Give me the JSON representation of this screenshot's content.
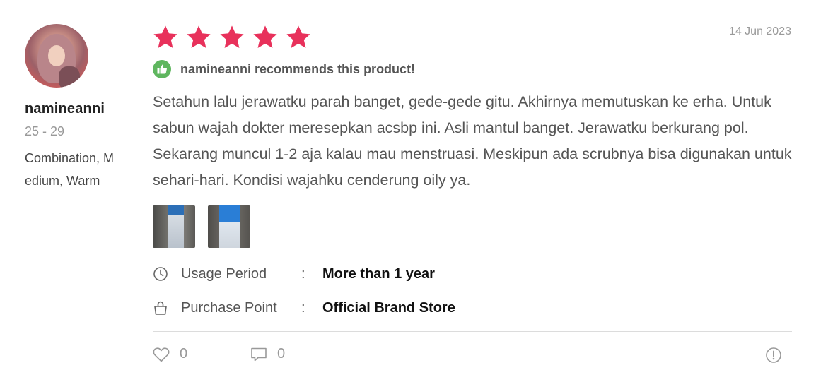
{
  "user": {
    "username": "namineanni",
    "age_range": "25 - 29",
    "skin_profile": "Combination, Medium, Warm"
  },
  "review": {
    "rating": 5,
    "max_rating": 5,
    "date": "14 Jun 2023",
    "recommendation": "namineanni recommends this product!",
    "text": "Setahun lalu jerawatku parah banget, gede-gede gitu. Akhirnya memutuskan ke erha. Untuk sabun wajah dokter meresepkan acsbp ini. Asli mantul banget. Jerawatku berkurang pol. Sekarang muncul 1-2 aja kalau mau menstruasi. Meskipun ada scrubnya bisa digunakan untuk sehari-hari. Kondisi wajahku cenderung oily ya.",
    "photos": [
      "review-photo-1",
      "review-photo-2"
    ]
  },
  "details": {
    "usage_label": "Usage Period",
    "usage_value": "More than 1 year",
    "purchase_label": "Purchase Point",
    "purchase_value": "Official Brand Store",
    "separator": ":"
  },
  "footer": {
    "likes": "0",
    "comments": "0"
  },
  "colors": {
    "star": "#e8315b",
    "recommend_badge": "#5fb65f",
    "muted_text": "#999999"
  },
  "icons": {
    "usage": "clock-icon",
    "purchase": "shopping-bag-icon",
    "like": "heart-icon",
    "comment": "comment-icon",
    "report": "report-icon",
    "recommend": "thumbs-up-icon"
  }
}
